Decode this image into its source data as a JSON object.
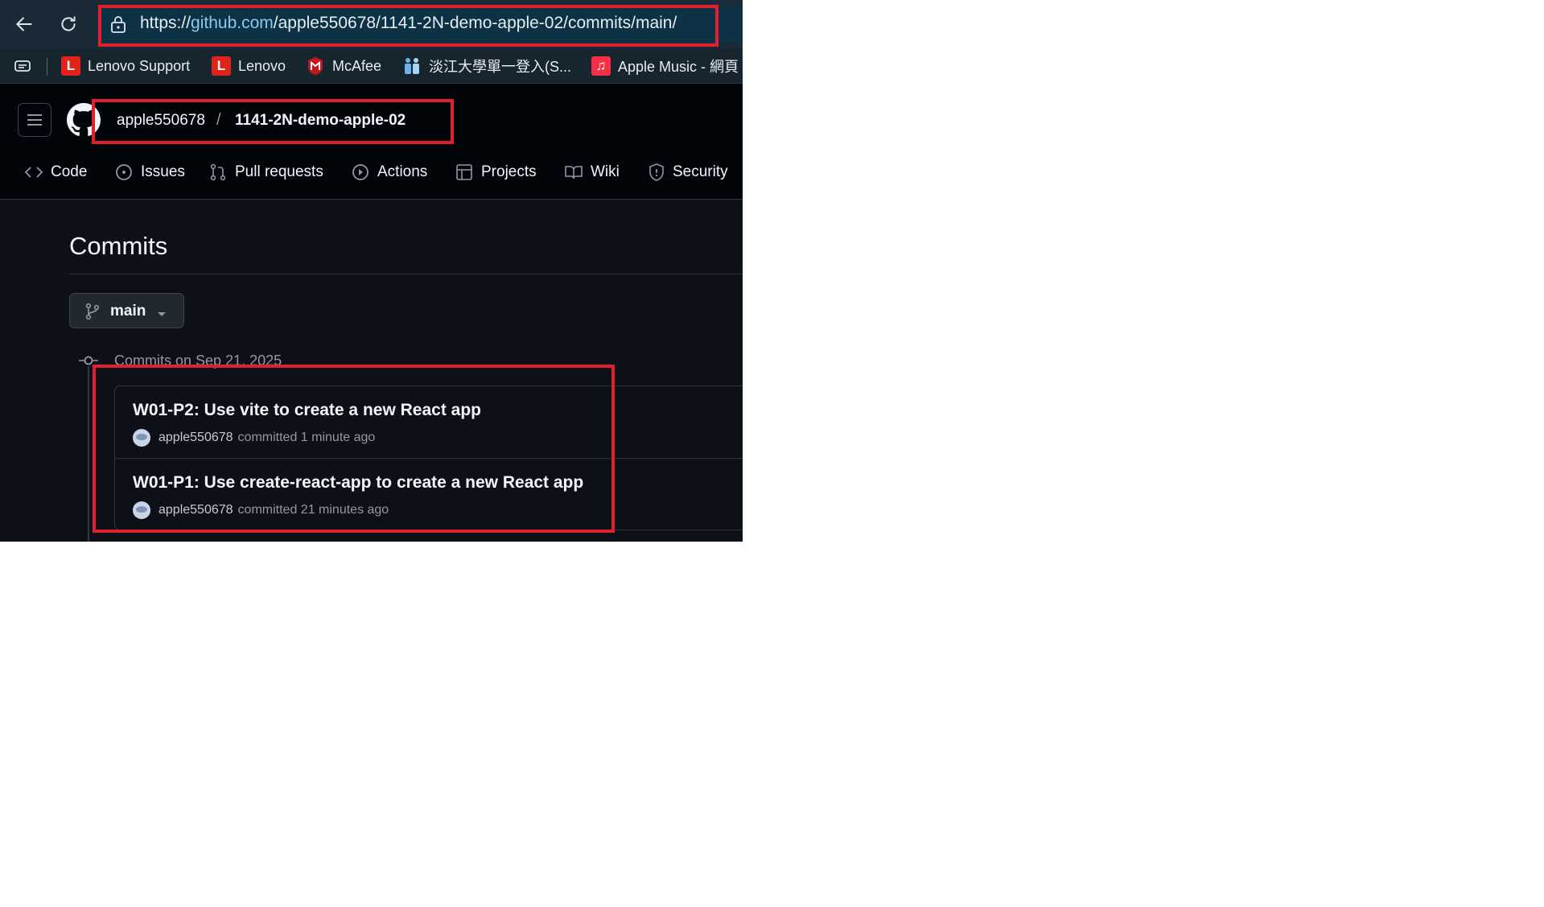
{
  "browser": {
    "url_scheme": "https://",
    "url_host": "github.com",
    "url_path": "/apple550678/1141-2N-demo-apple-02/commits/main/",
    "bookmarks": [
      {
        "label": "Lenovo Support",
        "icon": "lenovo-favicon",
        "badge": "L",
        "color": "#e2231a"
      },
      {
        "label": "Lenovo",
        "icon": "lenovo-favicon",
        "badge": "L",
        "color": "#e2231a"
      },
      {
        "label": "McAfee",
        "icon": "mcafee-favicon",
        "badge": "M",
        "color": "#c01818"
      },
      {
        "label": "淡江大學單一登入(S...",
        "icon": "tku-favicon",
        "badge": "",
        "color": "#5aa0e0"
      },
      {
        "label": "Apple Music - 網頁",
        "icon": "apple-music-favicon",
        "badge": "♫",
        "color": "#fa2d48"
      }
    ]
  },
  "repo": {
    "owner": "apple550678",
    "separator": "/",
    "name": "1141-2N-demo-apple-02"
  },
  "tabs": [
    {
      "label": "Code",
      "icon": "code-icon"
    },
    {
      "label": "Issues",
      "icon": "issue-icon"
    },
    {
      "label": "Pull requests",
      "icon": "pull-request-icon"
    },
    {
      "label": "Actions",
      "icon": "actions-icon"
    },
    {
      "label": "Projects",
      "icon": "projects-icon"
    },
    {
      "label": "Wiki",
      "icon": "book-icon"
    },
    {
      "label": "Security",
      "icon": "shield-icon"
    }
  ],
  "page": {
    "title": "Commits",
    "branch": "main",
    "group_label": "Commits on Sep 21, 2025"
  },
  "commits": [
    {
      "message": "W01-P2: Use vite to create a new React app",
      "author": "apple550678",
      "verb": "committed",
      "time": "1 minute ago"
    },
    {
      "message": "W01-P1: Use create-react-app to create a new React app",
      "author": "apple550678",
      "verb": "committed",
      "time": "21 minutes ago"
    }
  ],
  "colors": {
    "annotation": "#e0202e",
    "page_bg": "#0d1117",
    "header_bg": "#010409"
  }
}
